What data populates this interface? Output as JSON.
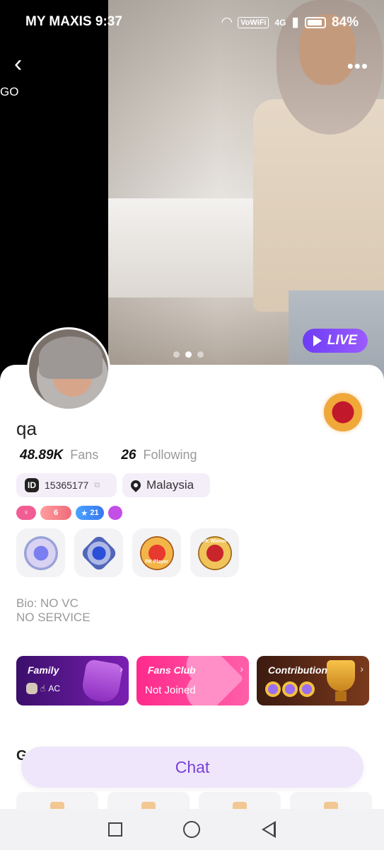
{
  "status_bar": {
    "carrier_time": "MY MAXIS 9:37",
    "vowifi": "VoWiFi",
    "network": "4G",
    "battery": "84%"
  },
  "header": {
    "back_icon": "chevron-left-icon",
    "more_icon": "more-horizontal-icon",
    "left_edge_text": "GO"
  },
  "hero": {
    "live_label": "LIVE",
    "carousel_dots": 3,
    "active_dot": 1
  },
  "profile": {
    "name": "qa",
    "fans_count": "48.89K",
    "fans_label": "Fans",
    "following_count": "26",
    "following_label": "Following",
    "id_icon": "ID",
    "user_id": "15365177",
    "location": "Malaysia",
    "badges": [
      {
        "text": "",
        "color": "#f15d93"
      },
      {
        "text": "6",
        "color": "#f06b7a"
      },
      {
        "text": "21",
        "color": "#3877f0"
      },
      {
        "text": "",
        "color": "#c34fe6"
      }
    ],
    "honors": [
      "PK Player",
      "PK Winner"
    ],
    "bio_line1": "Bio: NO VC",
    "bio_line2": "NO SERVICE"
  },
  "cards": {
    "family_title": "Family",
    "family_sub": "AC",
    "fans_club_title": "Fans Club",
    "fans_club_sub": "Not Joined",
    "contribution_title": "Contribution",
    "contribution_ranks": [
      "1",
      "2",
      "3"
    ]
  },
  "gifts": {
    "header": "G"
  },
  "chat_button": "Chat",
  "colors": {
    "accent": "#7a3fd6",
    "live_bg": "#6d3cf5",
    "fans_club": "#ff2a8c"
  }
}
